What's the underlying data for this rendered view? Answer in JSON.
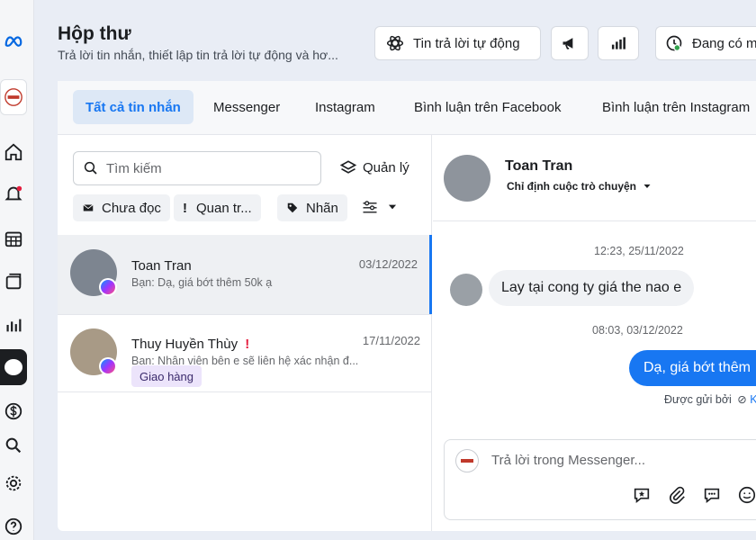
{
  "header": {
    "title": "Hộp thư",
    "subtitle": "Trả lời tin nhắn, thiết lập tin trả lời tự động và hơ...",
    "auto_reply_label": "Tin trả lời tự động",
    "status_label": "Đang có m"
  },
  "tabs": [
    {
      "label": "Tất cả tin nhắn",
      "active": true
    },
    {
      "label": "Messenger"
    },
    {
      "label": "Instagram"
    },
    {
      "label": "Bình luận trên Facebook"
    },
    {
      "label": "Bình luận trên Instagram"
    }
  ],
  "list": {
    "search_placeholder": "Tìm kiếm",
    "manage_label": "Quản lý",
    "filters": [
      "Chưa đọc",
      "Quan tr...",
      "Nhãn"
    ],
    "conversations": [
      {
        "name": "Toan Tran",
        "preview": "Bạn: Dạ, giá bớt thêm 50k ạ",
        "date": "03/12/2022"
      },
      {
        "name": "Thuy Huyền Thùy",
        "flag": "!",
        "preview": "Bạn: Nhân viên bên e sẽ liên hệ xác nhận đ...",
        "date": "17/11/2022",
        "tag": "Giao hàng"
      }
    ]
  },
  "chat": {
    "name": "Toan Tran",
    "assign_label": "Chỉ định cuộc trò chuyện",
    "stamp1": "12:23, 25/11/2022",
    "incoming": "Lay tại cong ty giá the nao e",
    "stamp2": "08:03, 03/12/2022",
    "outgoing": "Dạ, giá bớt thêm",
    "sent_by": "Được gửi bởi",
    "sent_by_initial": "K",
    "reply_placeholder": "Trả lời trong Messenger..."
  }
}
